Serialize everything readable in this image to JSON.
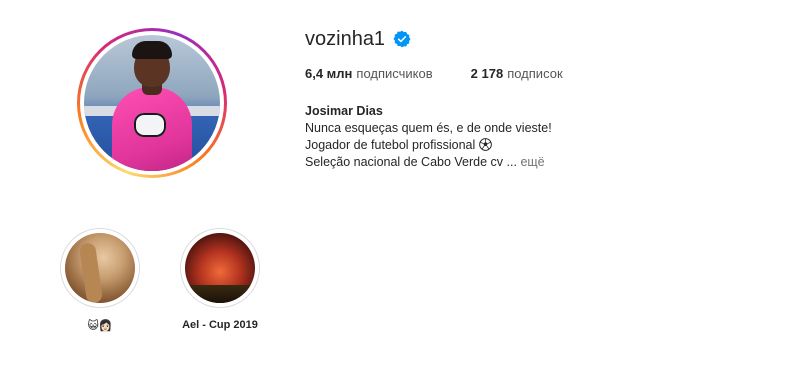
{
  "profile": {
    "username": "vozinha1",
    "followers_count": "6,4 млн",
    "followers_label": "подписчиков",
    "following_count": "2 178",
    "following_label": "подписок",
    "full_name": "Josimar Dias",
    "bio_line1": "Nunca esqueças quem és, e de onde vieste!",
    "bio_line2": "Jogador de futebol profissional",
    "bio_line3": "Seleção nacional de Cabo Verde cv ...",
    "more_label": "ещё"
  },
  "highlights": [
    {
      "label": "😺👩🏻"
    },
    {
      "label": "Ael - Cup 2019"
    }
  ],
  "icons": {
    "verified": "verified-badge-icon",
    "soccer_ball": "soccer-ball-icon"
  },
  "colors": {
    "verified_blue": "#0095f6",
    "text_primary": "#262626",
    "text_secondary": "#737373"
  }
}
